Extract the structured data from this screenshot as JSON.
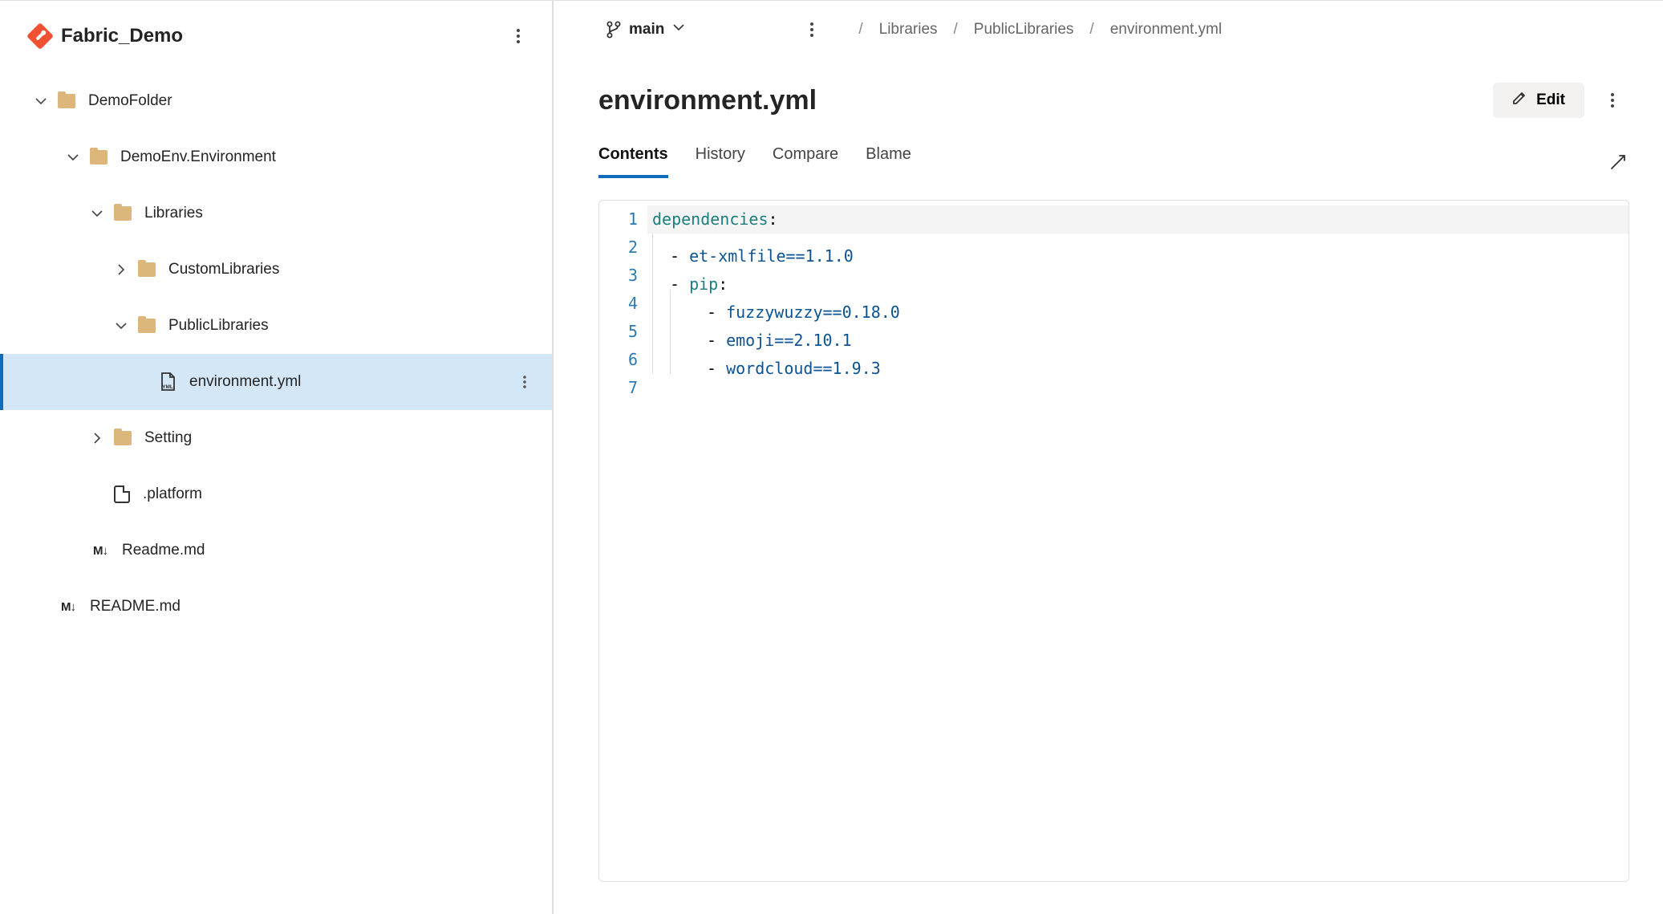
{
  "repo": {
    "name": "Fabric_Demo"
  },
  "tree": {
    "folder1": "DemoFolder",
    "folder2": "DemoEnv.Environment",
    "folder3": "Libraries",
    "folder4": "CustomLibraries",
    "folder5": "PublicLibraries",
    "file1": "environment.yml",
    "folder6": "Setting",
    "file2": ".platform",
    "file3": "Readme.md",
    "file4": "README.md"
  },
  "branch": {
    "name": "main"
  },
  "breadcrumb": {
    "c1": "Libraries",
    "c2": "PublicLibraries",
    "c3": "environment.yml"
  },
  "file": {
    "title": "environment.yml"
  },
  "buttons": {
    "edit": "Edit"
  },
  "tabs": {
    "t1": "Contents",
    "t2": "History",
    "t3": "Compare",
    "t4": "Blame"
  },
  "code": {
    "n1": "1",
    "n2": "2",
    "n3": "3",
    "n4": "4",
    "n5": "5",
    "n6": "6",
    "n7": "7",
    "l1_k": "dependencies",
    "l2_p": "et-xmlfile==1.1.0",
    "l3_k": "pip",
    "l4_p": "fuzzywuzzy==0.18.0",
    "l5_p": "emoji==2.10.1",
    "l6_p": "wordcloud==1.9.3"
  }
}
